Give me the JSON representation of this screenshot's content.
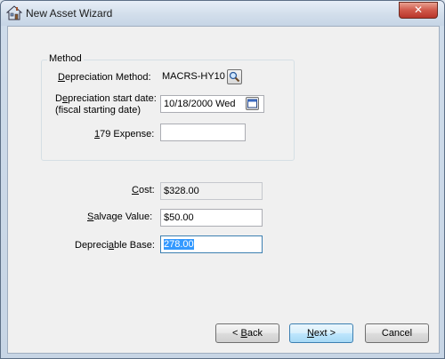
{
  "window": {
    "title": "New Asset Wizard",
    "close_label": "✕"
  },
  "method_group": {
    "title": "Method",
    "depreciation_method": {
      "label_prefix": "",
      "label_ul": "D",
      "label_rest": "epreciation Method:",
      "value": "MACRS-HY10"
    },
    "start_date": {
      "label_line1_prefix": "D",
      "label_line1_ul": "e",
      "label_line1_rest": "preciation start date:",
      "label_line2": "(fiscal starting date)",
      "value": "10/18/2000 Wed"
    },
    "expense_179": {
      "label_ul": "1",
      "label_rest": "79 Expense:",
      "value": ""
    }
  },
  "fields": {
    "cost": {
      "label_ul": "C",
      "label_rest": "ost:",
      "value": "$328.00"
    },
    "salvage": {
      "label_ul": "S",
      "label_rest": "alvage Value:",
      "value": "$50.00"
    },
    "base": {
      "label_prefix": "Depreci",
      "label_ul": "a",
      "label_rest": "ble Base:",
      "value": "278.00"
    }
  },
  "buttons": {
    "back": {
      "prefix": "< ",
      "ul": "B",
      "rest": "ack"
    },
    "next": {
      "prefix": "",
      "ul": "N",
      "rest": "ext >"
    },
    "cancel": {
      "label": "Cancel"
    }
  },
  "icons": {
    "lookup": "magnifier-icon",
    "calendar": "calendar-icon",
    "app": "house-icon"
  }
}
